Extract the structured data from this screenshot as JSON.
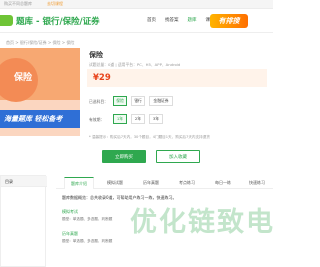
{
  "topbar": {
    "text": "购买不同总题库",
    "link": "去切课程"
  },
  "header": {
    "site_title": "题库 - 银行/保险/证券",
    "nav": [
      "首页",
      "找答案",
      "题库",
      "课程",
      "APP"
    ],
    "badge": "有排搜"
  },
  "breadcrumb": "首页 > 银行/保险/证券 > 保险 > 保险",
  "cover": {
    "title": "保险",
    "slogan": "海量题库 轻松备考"
  },
  "product": {
    "title": "保险",
    "meta": "试题总量：0道   |   适用平台：PC、H5、APP、Android",
    "price": "¥29"
  },
  "options": {
    "type_label": "已选科目：",
    "types": [
      "保险",
      "银行",
      "金融证券"
    ],
    "term_label": "有效期：",
    "terms": [
      "1年",
      "2年",
      "3年"
    ]
  },
  "note": "* 温馨提示：购买后7天内，30个题目，4门题目1天，购买后7天内支持退货",
  "buttons": {
    "buy": "立即购买",
    "fav": "加入收藏"
  },
  "left_box": {
    "title": "目录"
  },
  "tabs": [
    "题库介绍",
    "模拟试题",
    "历年真题",
    "考点练习",
    "每日一练",
    "快速练习"
  ],
  "content": {
    "desc": "题库数据概览：总共收录0道，可帮助用户练习一练，快速练习。",
    "sections": [
      {
        "title": "模拟考试",
        "meta": "题型：单选题、多选题、判断题"
      },
      {
        "title": "历年真题",
        "meta": "题型：单选题、多选题、判断题"
      }
    ]
  },
  "watermark": "优化链致电"
}
